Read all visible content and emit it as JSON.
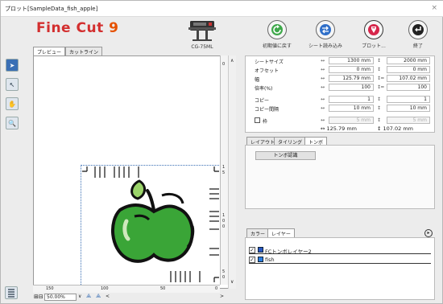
{
  "window": {
    "title": "プロット[SampleData_fish_apple]",
    "close_glyph": "×"
  },
  "logo": {
    "brand": "Fine Cut",
    "version": "9"
  },
  "device": {
    "model": "CG-75ML"
  },
  "toolbar": {
    "reset_label": "初期値に戻す",
    "read_sheet_label": "シート読み込み",
    "plot_label": "プロット...",
    "exit_label": "終了"
  },
  "tabs": {
    "preview": "プレビュー",
    "cutline": "カットライン"
  },
  "tools": [
    "arrow-icon",
    "select-icon",
    "hand-icon",
    "zoom-icon"
  ],
  "rulers": {
    "vertical": [
      "0",
      "1",
      "5",
      "1",
      "0",
      "0",
      "5",
      "0",
      "0"
    ],
    "horizontal": [
      "150",
      "100",
      "50",
      "0"
    ]
  },
  "status": {
    "zoom": "50.00%"
  },
  "properties": {
    "rows": [
      {
        "label": "シートサイズ",
        "w": "1300 mm",
        "h": "2000 mm",
        "dim": false
      },
      {
        "label": "オフセット",
        "w": "0 mm",
        "h": "0 mm",
        "dim": false
      },
      {
        "label": "幅",
        "w": "125.79 mm",
        "h": "107.02 mm",
        "dim": false
      },
      {
        "label": "倍率(%)",
        "w": "100",
        "h": "100",
        "dim": false
      },
      {
        "label": "コピー",
        "w": "1",
        "h": "1",
        "dim": false
      },
      {
        "label": "コピー間隔",
        "w": "10 mm",
        "h": "10 mm",
        "dim": false
      },
      {
        "label": "枠",
        "w": "5 mm",
        "h": "5 mm",
        "dim": true
      }
    ],
    "size_w": "↔ 125.79 mm",
    "size_h": "↕ 107.02 mm"
  },
  "tabs2": {
    "layout": "レイアウト",
    "tiling": "タイリング",
    "tombo": "トンボ"
  },
  "tombo_button": "トンボ認識",
  "tabs3": {
    "color": "カラー",
    "layer": "レイヤー"
  },
  "layers": [
    {
      "name": "FCトンボレイヤー2",
      "checked": true,
      "color": "#2857c4"
    },
    {
      "name": "fish",
      "checked": true,
      "color": "#2a7de1"
    }
  ],
  "colors": {
    "accent": "#3a6fb5",
    "logo_red": "#d32f2f",
    "apple_green": "#3aa537"
  }
}
